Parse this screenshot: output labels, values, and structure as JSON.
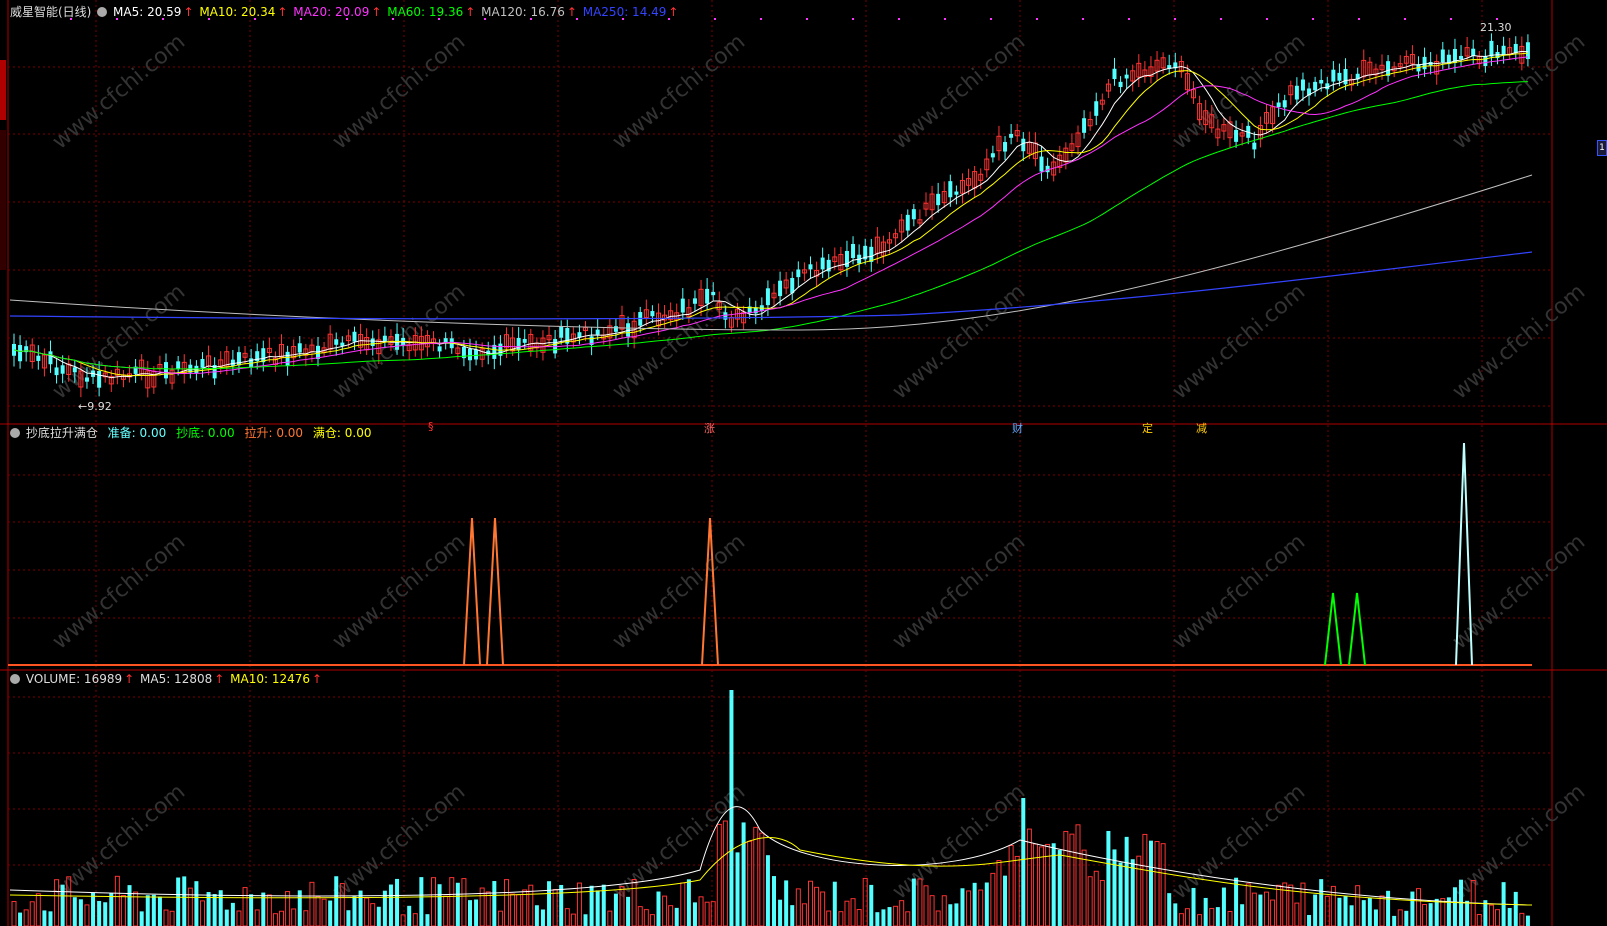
{
  "stock": {
    "title": "威星智能(日线)",
    "ma_lines": [
      {
        "label": "MA5: 20.59",
        "color": "#ffffff"
      },
      {
        "label": "MA10: 20.34",
        "color": "#ffff00"
      },
      {
        "label": "MA20: 20.09",
        "color": "#ff33ff"
      },
      {
        "label": "MA60: 19.36",
        "color": "#00ff00"
      },
      {
        "label": "MA120: 16.76",
        "color": "#c0c0c0"
      },
      {
        "label": "MA250: 14.49",
        "color": "#3344ff"
      }
    ],
    "high_label": "21.30",
    "low_label": "←9.92"
  },
  "indicator": {
    "title": "抄底拉升满仓",
    "values": [
      {
        "label": "准备: 0.00",
        "color": "#66ffff"
      },
      {
        "label": "抄底: 0.00",
        "color": "#00ff00"
      },
      {
        "label": "拉升: 0.00",
        "color": "#ff7733"
      },
      {
        "label": "满仓: 0.00",
        "color": "#ffff00"
      }
    ]
  },
  "volume": {
    "values": [
      {
        "label": "VOLUME: 16989",
        "color": "#dddddd"
      },
      {
        "label": "MA5: 12808",
        "color": "#dddddd"
      },
      {
        "label": "MA10: 12476",
        "color": "#ffff00"
      }
    ]
  },
  "events": [
    {
      "label": "§",
      "color": "#ff3333"
    },
    {
      "label": "涨",
      "color": "#ff6666"
    },
    {
      "label": "财",
      "color": "#66aaff"
    },
    {
      "label": "定",
      "color": "#ffcc00"
    },
    {
      "label": "减",
      "color": "#ffcc00"
    }
  ],
  "watermark": "www.cfchi.com",
  "right_marker": "1"
}
